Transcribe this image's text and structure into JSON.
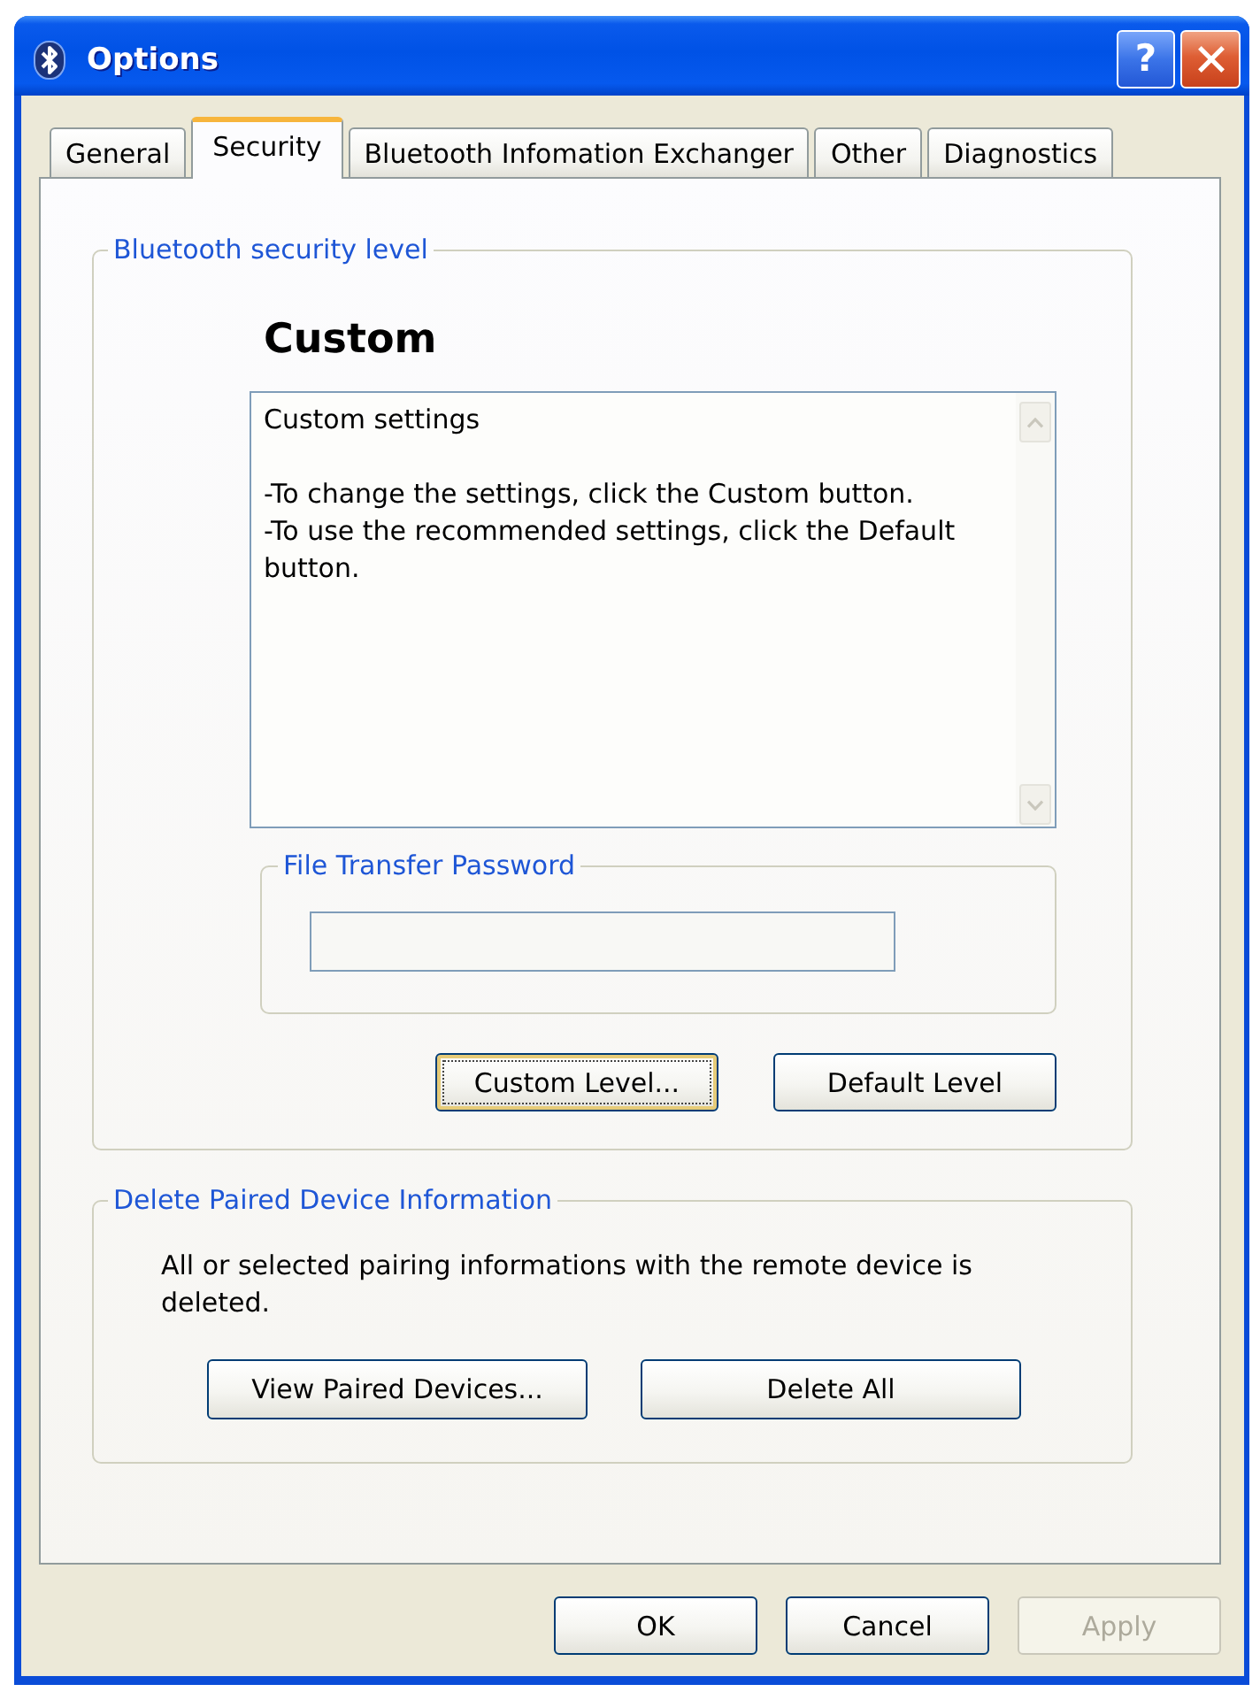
{
  "window": {
    "title": "Options",
    "help_button": "?"
  },
  "tabs": [
    {
      "label": "General",
      "selected": false
    },
    {
      "label": "Security",
      "selected": true
    },
    {
      "label": "Bluetooth Infomation Exchanger",
      "selected": false
    },
    {
      "label": "Other",
      "selected": false
    },
    {
      "label": "Diagnostics",
      "selected": false
    }
  ],
  "security_level": {
    "legend": "Bluetooth security level",
    "level_name": "Custom",
    "description": {
      "heading": "Custom settings",
      "lines": [
        "-To change the settings, click the Custom button.",
        "-To use the recommended settings, click the Default button."
      ]
    },
    "password": {
      "legend": "File Transfer Password"
    },
    "buttons": [
      {
        "label": "Custom Level...",
        "focused": true
      },
      {
        "label": "Default Level",
        "focused": false
      }
    ]
  },
  "paired_devices": {
    "legend": "Delete Paired Device Information",
    "text": "All or selected pairing informations with the remote device is deleted.",
    "buttons": [
      {
        "label": "View Paired Devices..."
      },
      {
        "label": "Delete All"
      }
    ]
  },
  "dialog_buttons": [
    {
      "label": "OK",
      "disabled": false
    },
    {
      "label": "Cancel",
      "disabled": false
    },
    {
      "label": "Apply",
      "disabled": true
    }
  ]
}
